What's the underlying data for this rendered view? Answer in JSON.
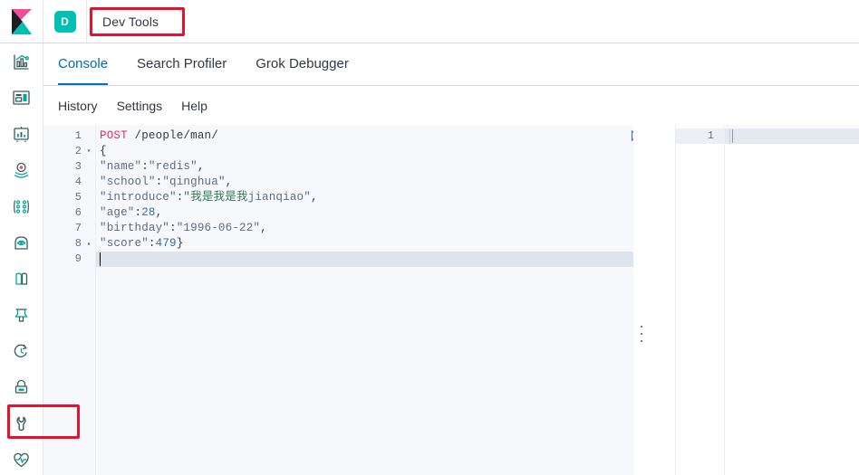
{
  "header": {
    "logo_icon": "kibana-logo",
    "space_badge": "D",
    "breadcrumb": "Dev Tools"
  },
  "sidebar": {
    "items": [
      {
        "icon": "analytics-chart-icon",
        "name": "analytics"
      },
      {
        "icon": "dashboard-layout-icon",
        "name": "dashboard"
      },
      {
        "icon": "canvas-board-icon",
        "name": "canvas"
      },
      {
        "icon": "maps-location-icon",
        "name": "maps"
      },
      {
        "icon": "machine-learning-nodes-icon",
        "name": "machine-learning"
      },
      {
        "icon": "observability-user-icon",
        "name": "observability"
      },
      {
        "icon": "logs-pages-icon",
        "name": "logs"
      },
      {
        "icon": "apm-beaker-icon",
        "name": "apm"
      },
      {
        "icon": "uptime-clock-arrow-icon",
        "name": "uptime"
      },
      {
        "icon": "security-lock-icon",
        "name": "security"
      },
      {
        "icon": "dev-tools-wrench-icon",
        "name": "dev-tools"
      },
      {
        "icon": "stack-monitoring-heart-icon",
        "name": "stack-monitoring"
      }
    ]
  },
  "tabs": [
    {
      "label": "Console",
      "active": true
    },
    {
      "label": "Search Profiler",
      "active": false
    },
    {
      "label": "Grok Debugger",
      "active": false
    }
  ],
  "submenu": [
    {
      "label": "History"
    },
    {
      "label": "Settings"
    },
    {
      "label": "Help"
    }
  ],
  "editor": {
    "actions": [
      {
        "icon": "play-send-request-icon",
        "name": "send-request"
      },
      {
        "icon": "wrench-tools-icon",
        "name": "console-tools"
      }
    ],
    "lines": [
      {
        "num": "1",
        "fold": ""
      },
      {
        "num": "2",
        "fold": "▾"
      },
      {
        "num": "3",
        "fold": ""
      },
      {
        "num": "4",
        "fold": ""
      },
      {
        "num": "5",
        "fold": ""
      },
      {
        "num": "6",
        "fold": ""
      },
      {
        "num": "7",
        "fold": ""
      },
      {
        "num": "8",
        "fold": "▴"
      },
      {
        "num": "9",
        "fold": ""
      }
    ],
    "code": {
      "method": "POST",
      "url": "/people/man/",
      "open_brace": "{",
      "key_name": "\"name\"",
      "val_name": "\"redis\"",
      "key_school": "\"school\"",
      "val_school": "\"qinghua\"",
      "key_introduce": "\"introduce\"",
      "val_introduce_cjk": "\"我是我是我",
      "val_introduce_latin": "jianqiao\"",
      "key_age": "\"age\"",
      "val_age": "28",
      "key_birthday": "\"birthday\"",
      "val_birthday": "\"1996-06-22\"",
      "key_score": "\"score\"",
      "val_score": "479",
      "close_brace": "}",
      "colon": ":",
      "comma": ","
    }
  },
  "response": {
    "line_number": "1",
    "body": ""
  },
  "colors": {
    "accent_blue": "#0071c2",
    "tab_active_text": "#006bb4",
    "teal_badge": "#00bfb3",
    "annotation_red": "#e8112d",
    "method_pink": "#d6336c",
    "cjk_green": "#2f7a55",
    "editor_bg": "#f7f8fc"
  }
}
